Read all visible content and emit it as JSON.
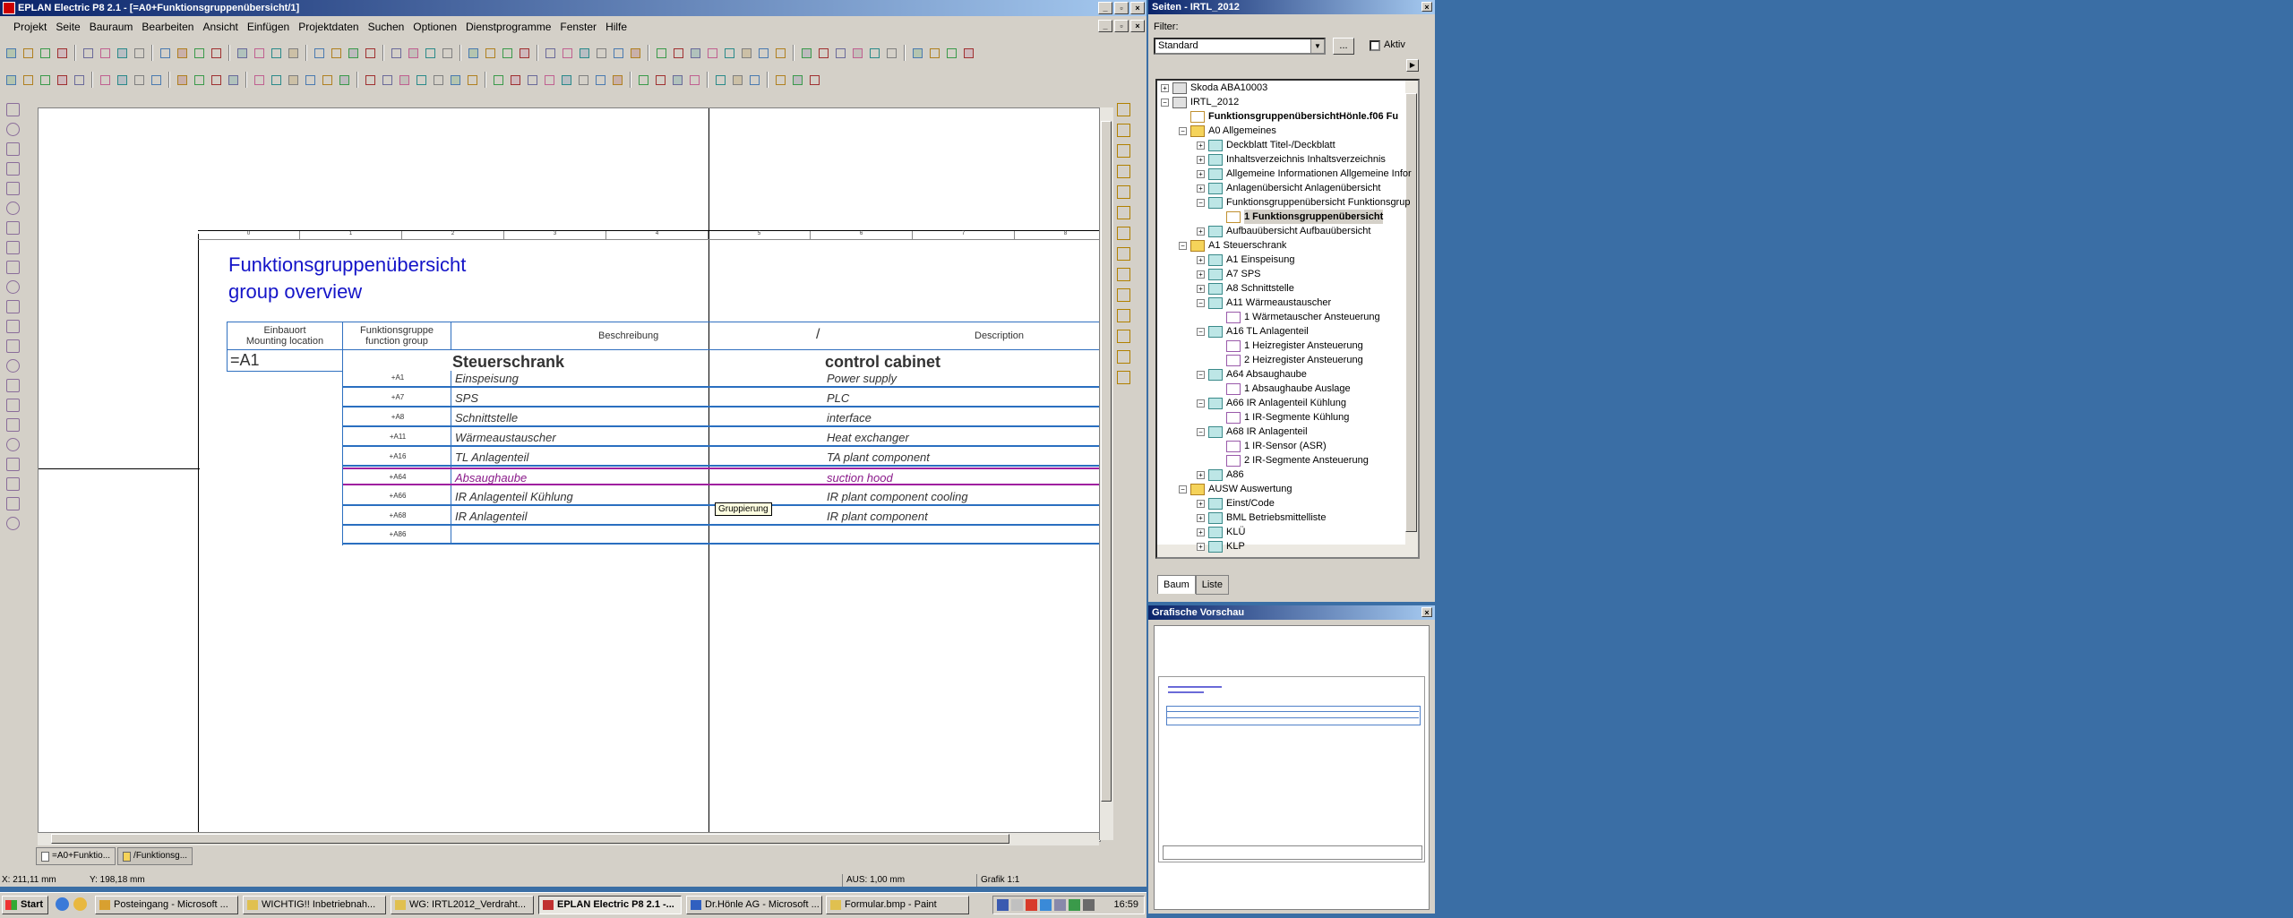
{
  "main_window": {
    "title": "EPLAN Electric P8 2.1 - [=A0+Funktionsgruppenübersicht/1]",
    "menu": [
      "Projekt",
      "Seite",
      "Bauraum",
      "Bearbeiten",
      "Ansicht",
      "Einfügen",
      "Projektdaten",
      "Suchen",
      "Optionen",
      "Dienstprogramme",
      "Fenster",
      "Hilfe"
    ]
  },
  "page": {
    "title_de": "Funktionsgruppenübersicht",
    "title_en": "group overview",
    "ruler": [
      "0",
      "1",
      "2",
      "3",
      "4",
      "5",
      "6",
      "7",
      "8"
    ],
    "headers": {
      "mounting": "Einbauort\nMounting location",
      "function_group": "Funktionsgruppe\nfunction group",
      "desc_de": "Beschreibung",
      "slash": "/",
      "desc_en": "Description"
    },
    "location": "=A1",
    "section_de": "Steuerschrank",
    "section_en": "control cabinet",
    "rows": [
      {
        "code": "+A1",
        "de": "Einspeisung",
        "en": "Power supply"
      },
      {
        "code": "+A7",
        "de": "SPS",
        "en": "PLC"
      },
      {
        "code": "+A8",
        "de": "Schnittstelle",
        "en": "interface"
      },
      {
        "code": "+A11",
        "de": "Wärmeaustauscher",
        "en": "Heat exchanger"
      },
      {
        "code": "+A16",
        "de": "TL Anlagenteil",
        "en": "TA plant component"
      },
      {
        "code": "+A64",
        "de": "Absaughaube",
        "en": "suction hood"
      },
      {
        "code": "+A66",
        "de": "IR Anlagenteil Kühlung",
        "en": "IR plant component cooling"
      },
      {
        "code": "+A68",
        "de": "IR Anlagenteil",
        "en": "IR plant component"
      },
      {
        "code": "+A86",
        "de": "",
        "en": ""
      }
    ],
    "tooltip": "Gruppierung"
  },
  "doc_tabs": [
    "=A0+Funktio...",
    "/Funktionsg..."
  ],
  "status": {
    "x": "X: 211,11 mm",
    "y": "Y: 198,18 mm",
    "aus": "AUS: 1,00 mm",
    "grafik": "Grafik 1:1"
  },
  "pages_panel": {
    "title": "Seiten - IRTL_2012",
    "filter_label": "Filter:",
    "filter_value": "Standard",
    "dots": "...",
    "aktiv": "Aktiv",
    "tabs": [
      "Baum",
      "Liste"
    ],
    "tree": [
      {
        "label": "Skoda ABA10003",
        "lvl": 0,
        "ex": "+",
        "ico": "proj"
      },
      {
        "label": "IRTL_2012",
        "lvl": 0,
        "ex": "-",
        "ico": "proj"
      },
      {
        "label": "FunktionsgruppenübersichtHönle.f06 Fu",
        "lvl": 1,
        "ex": "",
        "ico": "pageh",
        "bold": true
      },
      {
        "label": "A0 Allgemeines",
        "lvl": 1,
        "ex": "-",
        "ico": "fold"
      },
      {
        "label": "Deckblatt Titel-/Deckblatt",
        "lvl": 2,
        "ex": "+",
        "ico": "grp"
      },
      {
        "label": "Inhaltsverzeichnis Inhaltsverzeichnis",
        "lvl": 2,
        "ex": "+",
        "ico": "grp"
      },
      {
        "label": "Allgemeine Informationen Allgemeine Infor",
        "lvl": 2,
        "ex": "+",
        "ico": "grp"
      },
      {
        "label": "Anlagenübersicht Anlagenübersicht",
        "lvl": 2,
        "ex": "+",
        "ico": "grp"
      },
      {
        "label": "Funktionsgruppenübersicht Funktionsgrup",
        "lvl": 2,
        "ex": "-",
        "ico": "grp"
      },
      {
        "label": "1 Funktionsgruppenübersicht",
        "lvl": 3,
        "ex": "",
        "ico": "pageh",
        "bold": true,
        "sel": true
      },
      {
        "label": "Aufbauübersicht Aufbauübersicht",
        "lvl": 2,
        "ex": "+",
        "ico": "grp"
      },
      {
        "label": "A1 Steuerschrank",
        "lvl": 1,
        "ex": "-",
        "ico": "fold"
      },
      {
        "label": "A1 Einspeisung",
        "lvl": 2,
        "ex": "+",
        "ico": "grp"
      },
      {
        "label": "A7 SPS",
        "lvl": 2,
        "ex": "+",
        "ico": "grp"
      },
      {
        "label": "A8 Schnittstelle",
        "lvl": 2,
        "ex": "+",
        "ico": "grp"
      },
      {
        "label": "A11 Wärmeaustauscher",
        "lvl": 2,
        "ex": "-",
        "ico": "grp"
      },
      {
        "label": "1 Wärmetauscher Ansteuerung",
        "lvl": 3,
        "ex": "",
        "ico": "page"
      },
      {
        "label": "A16 TL Anlagenteil",
        "lvl": 2,
        "ex": "-",
        "ico": "grp"
      },
      {
        "label": "1 Heizregister Ansteuerung",
        "lvl": 3,
        "ex": "",
        "ico": "page"
      },
      {
        "label": "2 Heizregister Ansteuerung",
        "lvl": 3,
        "ex": "",
        "ico": "page"
      },
      {
        "label": "A64 Absaughaube",
        "lvl": 2,
        "ex": "-",
        "ico": "grp"
      },
      {
        "label": "1 Absaughaube Auslage",
        "lvl": 3,
        "ex": "",
        "ico": "page"
      },
      {
        "label": "A66 IR Anlagenteil Kühlung",
        "lvl": 2,
        "ex": "-",
        "ico": "grp"
      },
      {
        "label": "1 IR-Segmente Kühlung",
        "lvl": 3,
        "ex": "",
        "ico": "page"
      },
      {
        "label": "A68 IR Anlagenteil",
        "lvl": 2,
        "ex": "-",
        "ico": "grp"
      },
      {
        "label": "1 IR-Sensor (ASR)",
        "lvl": 3,
        "ex": "",
        "ico": "page"
      },
      {
        "label": "2 IR-Segmente Ansteuerung",
        "lvl": 3,
        "ex": "",
        "ico": "page"
      },
      {
        "label": "A86",
        "lvl": 2,
        "ex": "+",
        "ico": "grp"
      },
      {
        "label": "AUSW Auswertung",
        "lvl": 1,
        "ex": "-",
        "ico": "fold"
      },
      {
        "label": "Einst/Code",
        "lvl": 2,
        "ex": "+",
        "ico": "grp"
      },
      {
        "label": "BML Betriebsmittelliste",
        "lvl": 2,
        "ex": "+",
        "ico": "grp"
      },
      {
        "label": "KLÜ",
        "lvl": 2,
        "ex": "+",
        "ico": "grp"
      },
      {
        "label": "KLP",
        "lvl": 2,
        "ex": "+",
        "ico": "grp"
      }
    ]
  },
  "preview_panel": {
    "title": "Grafische Vorschau"
  },
  "taskbar": {
    "start": "Start",
    "tasks": [
      {
        "label": "Posteingang - Microsoft ...",
        "color": "#d8a030"
      },
      {
        "label": "WICHTIG!! Inbetriebnah...",
        "color": "#e0c050"
      },
      {
        "label": "WG: IRTL2012_Verdraht...",
        "color": "#e0c050"
      },
      {
        "label": "EPLAN Electric P8 2.1 -...",
        "color": "#c03030",
        "active": true
      },
      {
        "label": "Dr.Hönle AG - Microsoft ...",
        "color": "#3060c0"
      },
      {
        "label": "Formular.bmp - Paint",
        "color": "#e0c050"
      }
    ],
    "clock": "16:59"
  }
}
